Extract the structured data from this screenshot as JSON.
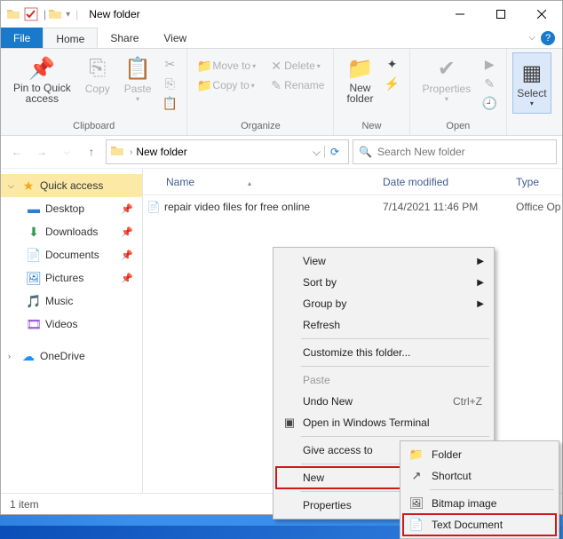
{
  "title": "New folder",
  "tabs": {
    "file": "File",
    "home": "Home",
    "share": "Share",
    "view": "View"
  },
  "ribbon": {
    "clipboard": {
      "pin": "Pin to Quick\naccess",
      "copy": "Copy",
      "paste": "Paste",
      "label": "Clipboard"
    },
    "organize": {
      "moveto": "Move to",
      "copyto": "Copy to",
      "delete": "Delete",
      "rename": "Rename",
      "label": "Organize"
    },
    "new": {
      "newfolder": "New\nfolder",
      "label": "New"
    },
    "open": {
      "properties": "Properties",
      "label": "Open"
    },
    "select": {
      "select": "Select"
    }
  },
  "address": {
    "folder": "New folder"
  },
  "search": {
    "placeholder": "Search New folder"
  },
  "sidebar": {
    "quickaccess": "Quick access",
    "items": [
      {
        "label": "Desktop"
      },
      {
        "label": "Downloads"
      },
      {
        "label": "Documents"
      },
      {
        "label": "Pictures"
      },
      {
        "label": "Music"
      },
      {
        "label": "Videos"
      }
    ],
    "onedrive": "OneDrive"
  },
  "columns": {
    "name": "Name",
    "date": "Date modified",
    "type": "Type"
  },
  "files": [
    {
      "name": "repair video files for free online",
      "date": "7/14/2021 11:46 PM",
      "type": "Office Op"
    }
  ],
  "status": {
    "count": "1 item"
  },
  "ctx": {
    "view": "View",
    "sortby": "Sort by",
    "groupby": "Group by",
    "refresh": "Refresh",
    "customize": "Customize this folder...",
    "paste": "Paste",
    "undo": "Undo New",
    "undo_shortcut": "Ctrl+Z",
    "terminal": "Open in Windows Terminal",
    "giveaccess": "Give access to",
    "new": "New",
    "properties": "Properties"
  },
  "submenu": {
    "folder": "Folder",
    "shortcut": "Shortcut",
    "bitmap": "Bitmap image",
    "text": "Text Document"
  }
}
